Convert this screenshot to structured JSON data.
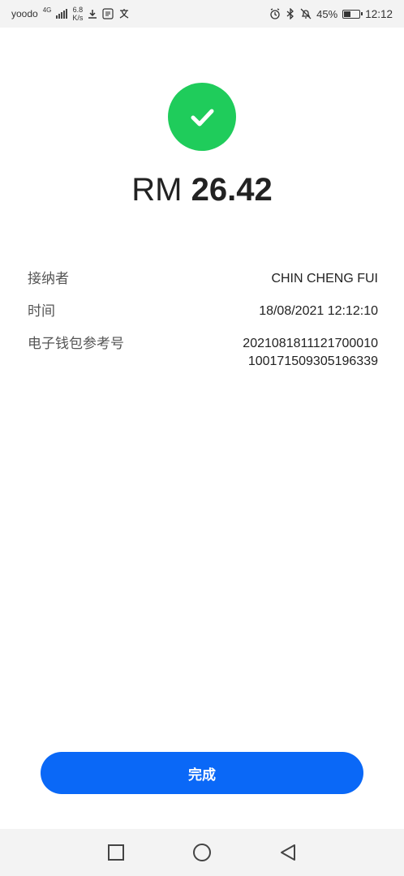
{
  "status_bar": {
    "carrier": "yoodo",
    "network": "4G",
    "speed_value": "6.8",
    "speed_unit": "K/s",
    "battery_percent": "45%",
    "battery_level": 0.45,
    "time": "12:12"
  },
  "payment": {
    "currency": "RM",
    "amount": "26.42"
  },
  "details": {
    "recipient_label": "接纳者",
    "recipient_value": "CHIN CHENG FUI",
    "time_label": "时间",
    "time_value": "18/08/2021 12:12:10",
    "reference_label": "电子钱包参考号",
    "reference_line1": "2021081811121700010",
    "reference_line2": "100171509305196339"
  },
  "actions": {
    "done_label": "完成"
  },
  "colors": {
    "success_green": "#1fcc5b",
    "button_blue": "#0a68f7"
  }
}
